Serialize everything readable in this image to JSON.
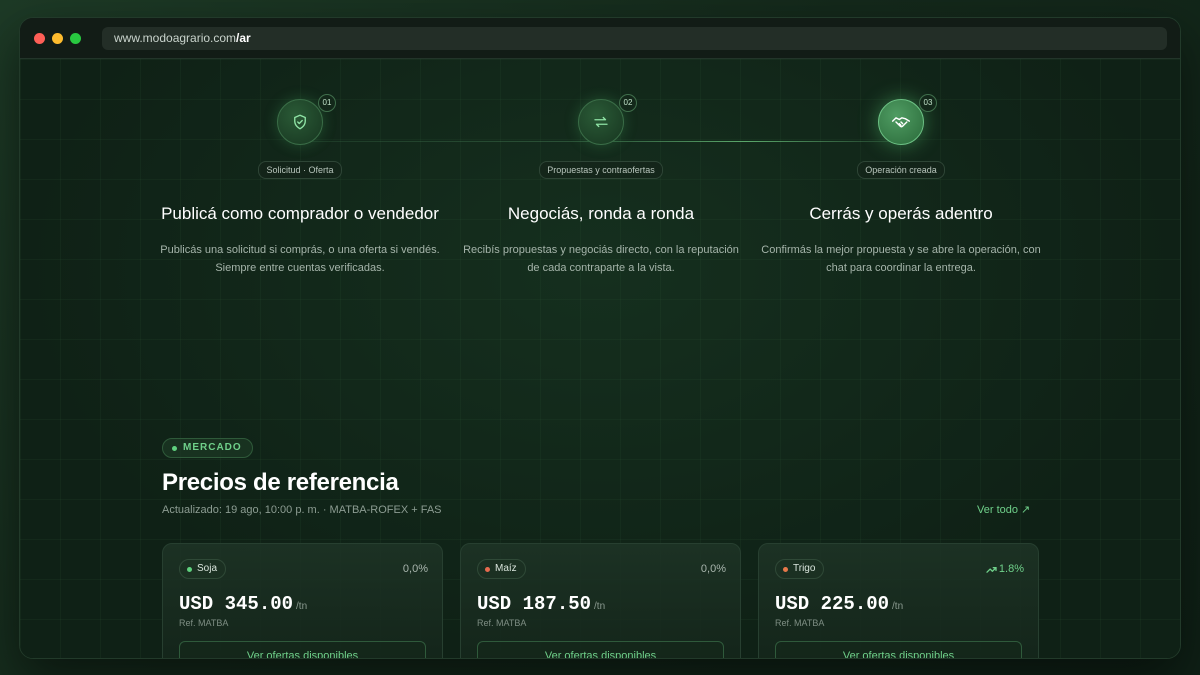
{
  "browser": {
    "domain": "www.modoagrario.com",
    "path": "/ar"
  },
  "steps": [
    {
      "num": "01",
      "badge": "Solicitud · Oferta",
      "title": "Publicá como comprador o vendedor",
      "desc": "Publicás una solicitud si comprás, o una oferta si vendés. Siempre entre cuentas verificadas.",
      "icon": "shield-check-icon"
    },
    {
      "num": "02",
      "badge": "Propuestas y contraofertas",
      "title": "Negociás, ronda a ronda",
      "desc": "Recibís propuestas y negociás directo, con la reputación de cada contraparte a la vista.",
      "icon": "arrows-exchange-icon"
    },
    {
      "num": "03",
      "badge": "Operación creada",
      "title": "Cerrás y operás adentro",
      "desc": "Confirmás la mejor propuesta y se abre la operación, con chat para coordinar la entrega.",
      "icon": "handshake-icon"
    }
  ],
  "market": {
    "tag": "MERCADO",
    "title": "Precios de referencia",
    "subtitle": "Actualizado: 19 ago, 10:00 p. m. · MATBA-ROFEX + FAS",
    "ver_todo": "Ver todo ↗",
    "cards": [
      {
        "name": "Soja",
        "dot_color": "#5fd17e",
        "dot_icon": "sprout-icon",
        "change": "0,0%",
        "change_up": false,
        "price": "USD 345.00",
        "unit": "/tn",
        "ref": "Ref. MATBA",
        "button": "Ver ofertas disponibles"
      },
      {
        "name": "Maíz",
        "dot_color": "#e86b4f",
        "dot_icon": "dot-icon",
        "change": "0,0%",
        "change_up": false,
        "price": "USD 187.50",
        "unit": "/tn",
        "ref": "Ref. MATBA",
        "button": "Ver ofertas disponibles"
      },
      {
        "name": "Trigo",
        "dot_color": "#e8784a",
        "dot_icon": "dot-icon",
        "change": "1.8%",
        "change_up": true,
        "price": "USD 225.00",
        "unit": "/tn",
        "ref": "Ref. MATBA",
        "button": "Ver ofertas disponibles"
      }
    ]
  },
  "colors": {
    "accent": "#6fd08a",
    "background": "#0f2116"
  }
}
